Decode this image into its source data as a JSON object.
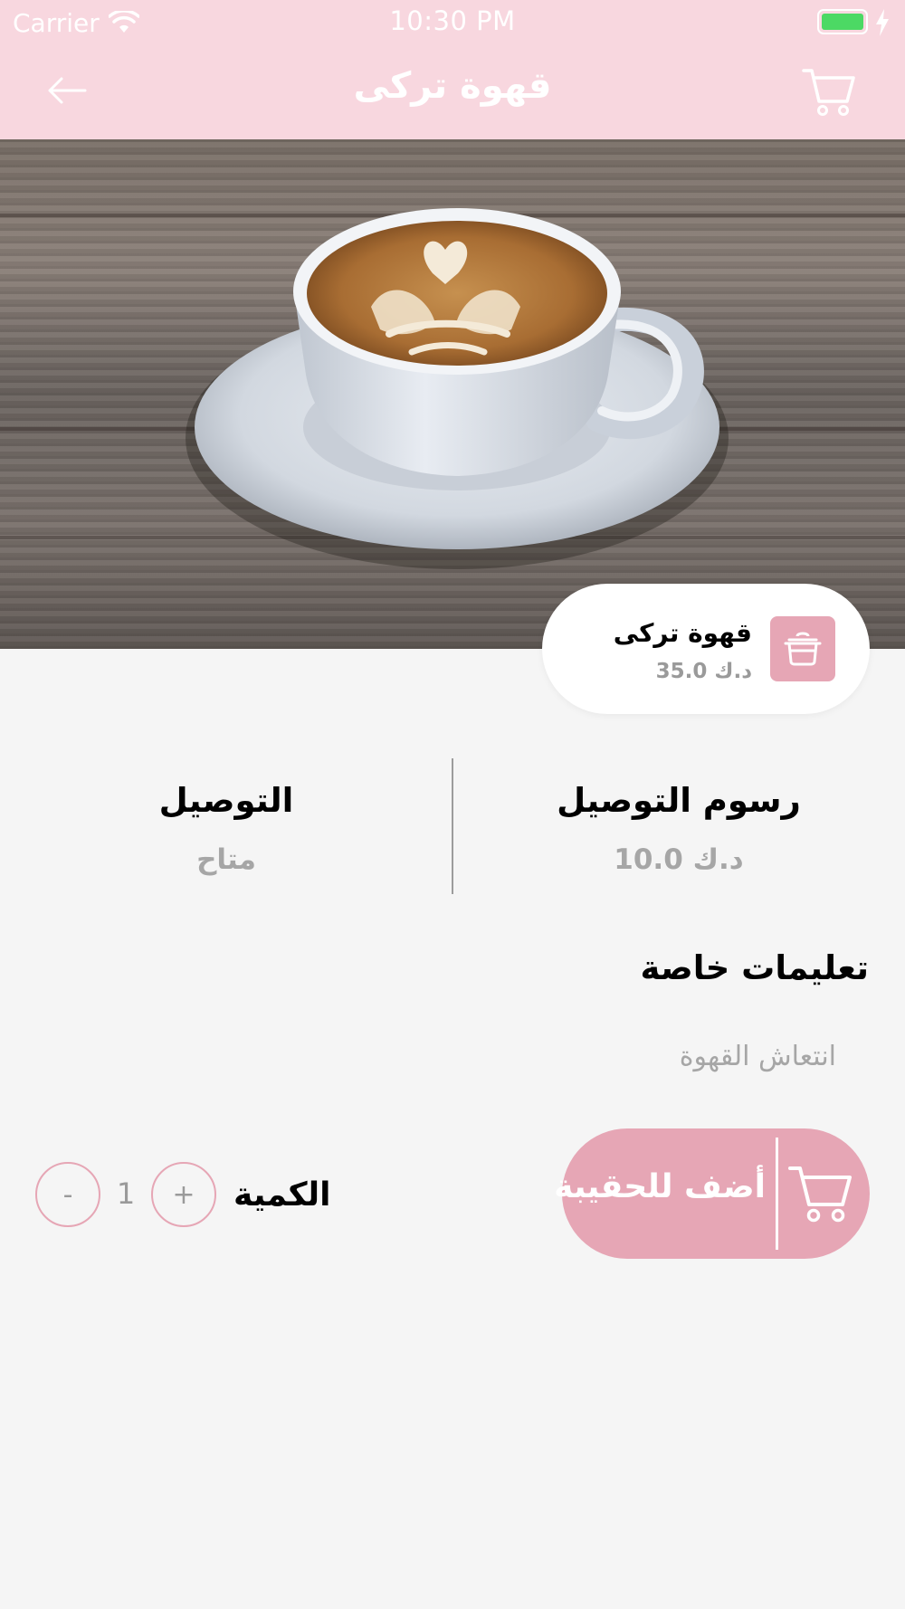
{
  "status_bar": {
    "carrier": "Carrier",
    "time": "10:30 PM",
    "battery_color": "#4cd964"
  },
  "nav": {
    "title": "قهوة تركى",
    "back_icon": "back-arrow-icon",
    "cart_icon": "cart-icon"
  },
  "product": {
    "image": "coffee-latte-art-photo",
    "name": "قهوة تركى",
    "price": "35.0 د.ك",
    "icon": "cooking-pot-icon"
  },
  "delivery": {
    "fee_heading": "رسوم التوصيل",
    "fee_value": "10.0 د.ك",
    "delivery_heading": "التوصيل",
    "delivery_value": "متاح"
  },
  "special_instructions": {
    "title": "تعليمات خاصة",
    "placeholder": "انتعاش القهوة",
    "value": ""
  },
  "add_to_bag": {
    "label": "أضف للحقيبة",
    "icon": "cart-icon"
  },
  "quantity": {
    "label": "الكمية",
    "value": "1",
    "plus_label": "+",
    "minus_label": "-"
  },
  "colors": {
    "header_pink": "#f8d7df",
    "accent_pink": "#e6a6b5",
    "background": "#f5f5f5",
    "muted_text": "#a6a6a6"
  }
}
